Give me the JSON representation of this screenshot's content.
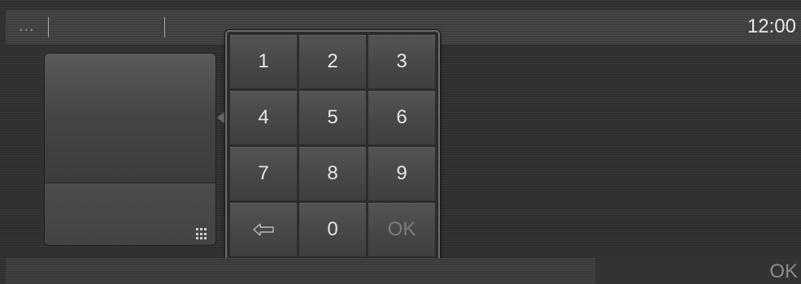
{
  "topbar": {
    "menu_dots": "...",
    "clock": "12:00"
  },
  "keypad": {
    "keys": [
      {
        "label": "1"
      },
      {
        "label": "2"
      },
      {
        "label": "3"
      },
      {
        "label": "4"
      },
      {
        "label": "5"
      },
      {
        "label": "6"
      },
      {
        "label": "7"
      },
      {
        "label": "8"
      },
      {
        "label": "9"
      },
      {
        "icon": "backspace-arrow-icon"
      },
      {
        "label": "0"
      },
      {
        "label": "OK"
      }
    ]
  },
  "bottombar": {
    "ok_label": "OK"
  },
  "colors": {
    "background": "#2f2f2f",
    "key": "#4a4a4a",
    "text": "#e6e6e6",
    "disabled_text": "#7d7d7d"
  }
}
